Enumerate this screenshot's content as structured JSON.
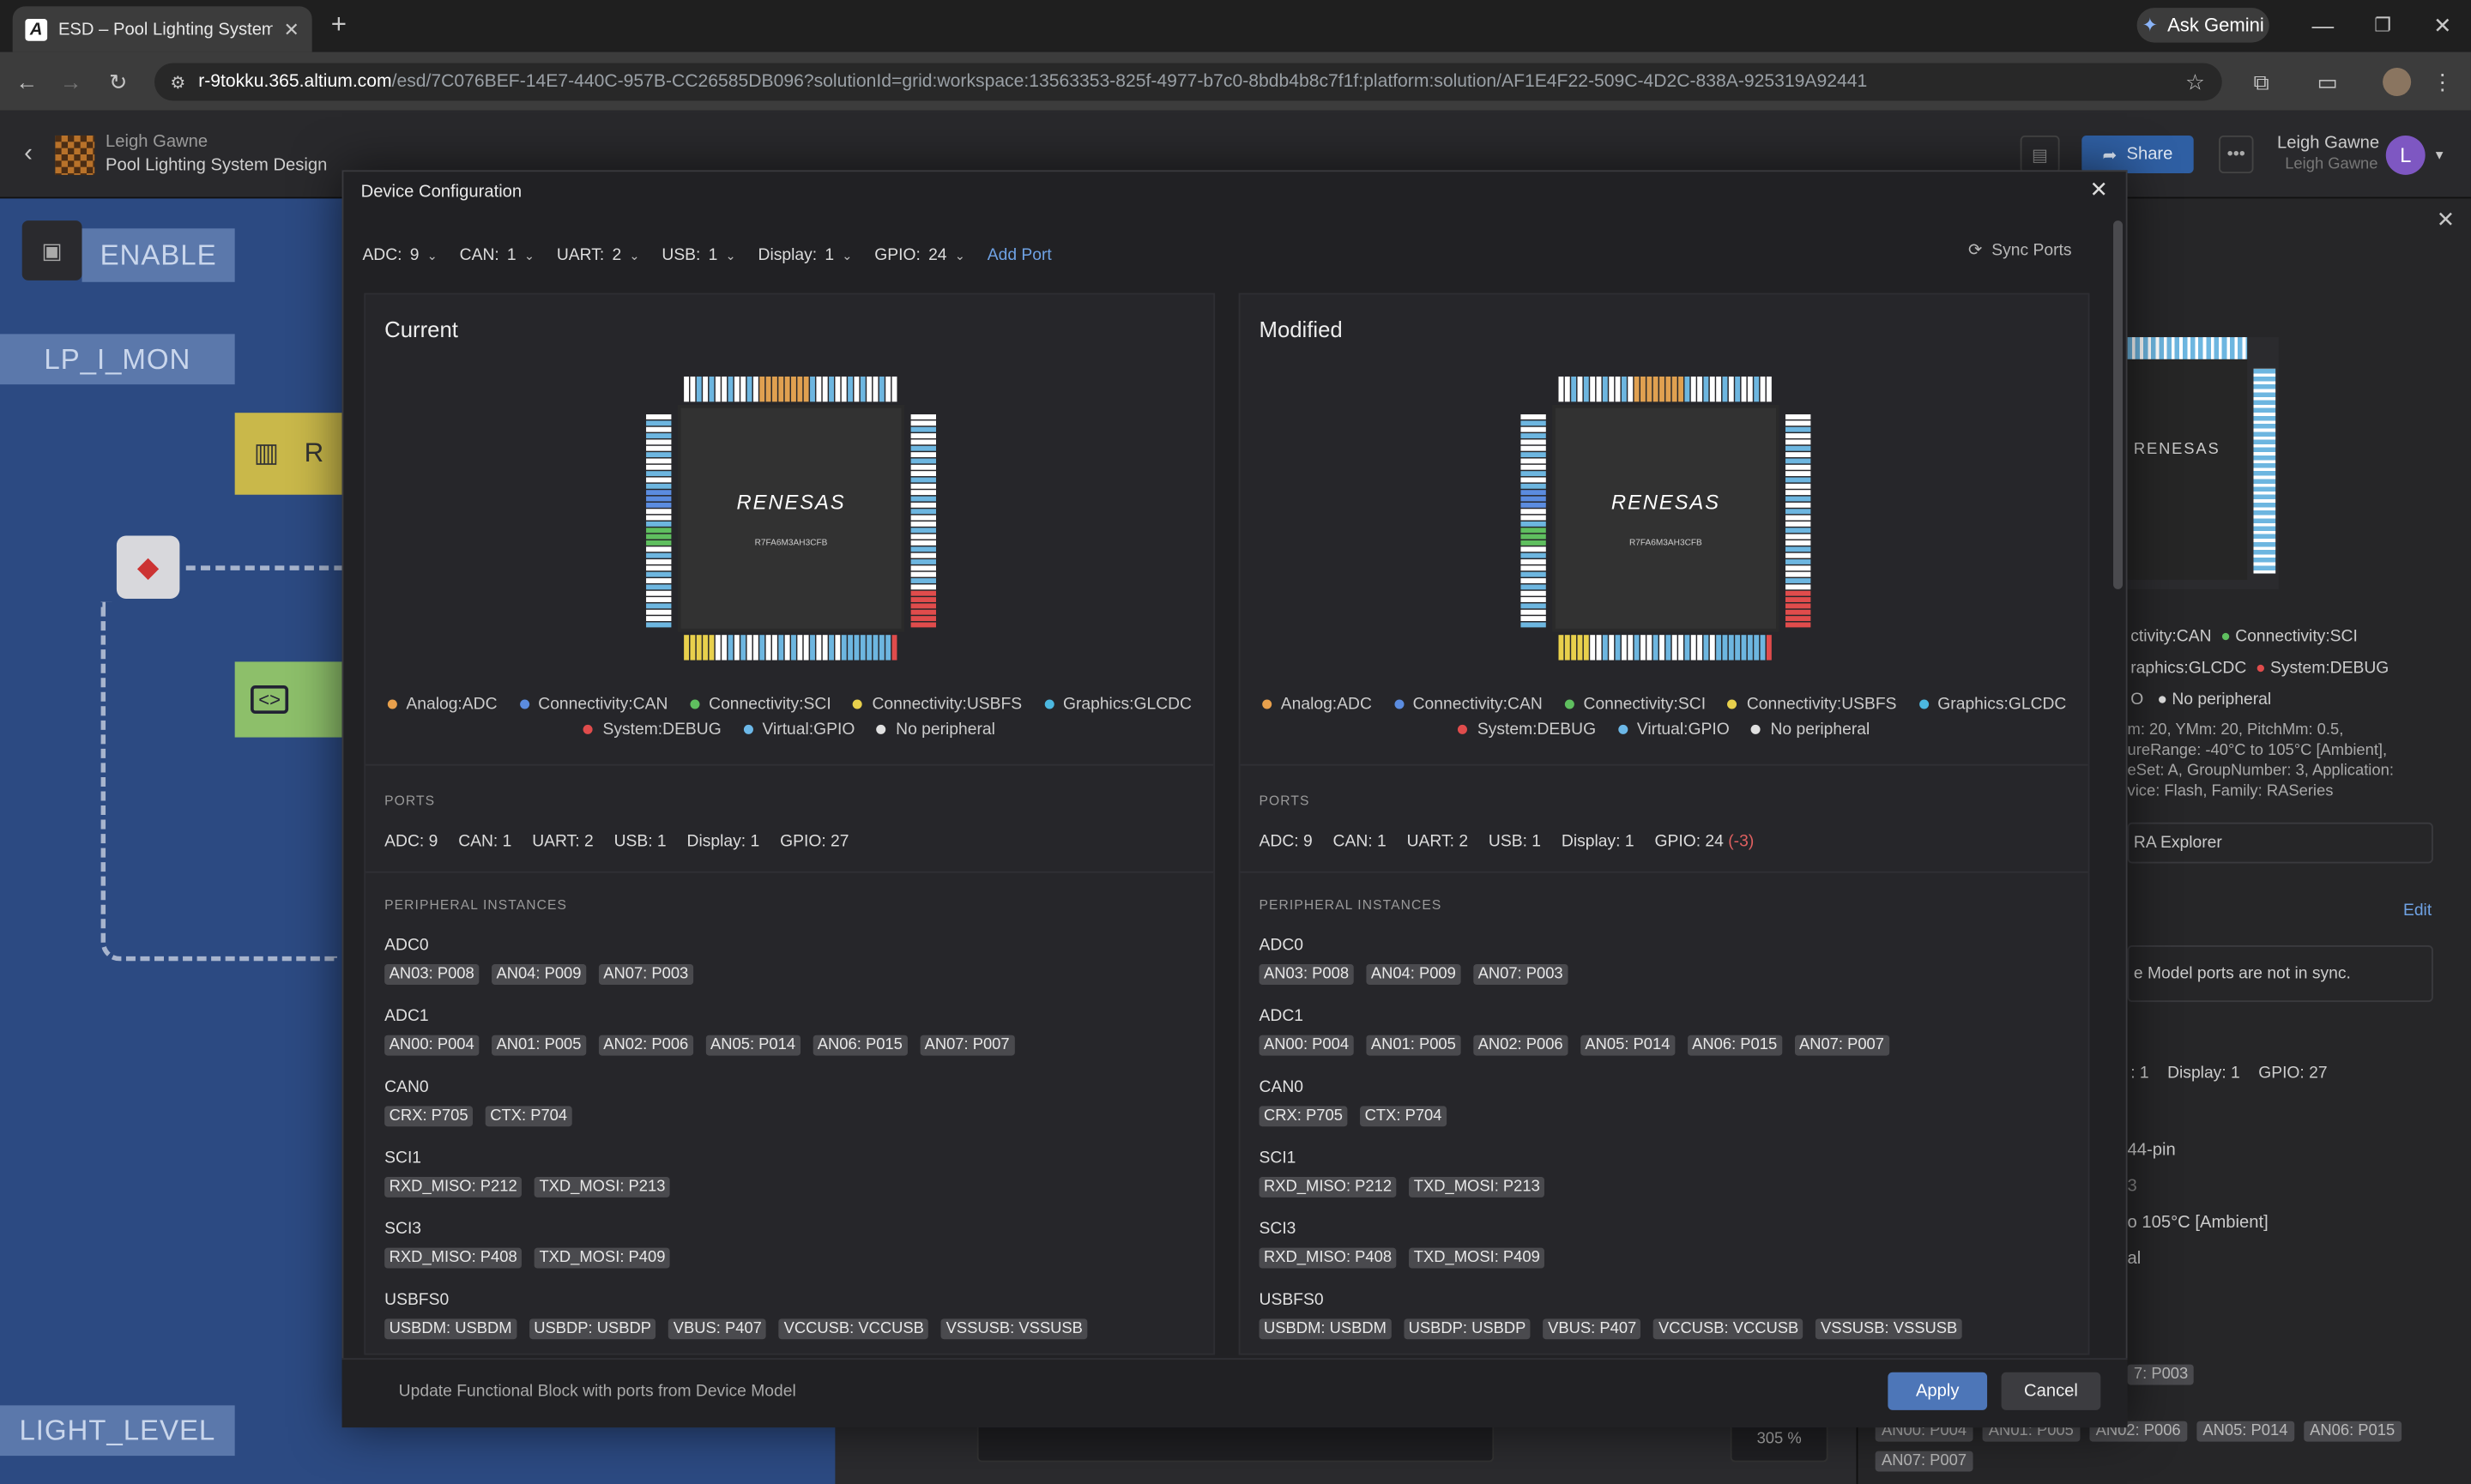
{
  "browser": {
    "tab_title": "ESD – Pool Lighting System Des",
    "url_host": "r-9tokku.365.altium.com",
    "url_path": "/esd/7C076BEF-14E7-440C-957B-CC26585DB096?solutionId=grid:workspace:13563353-825f-4977-b7c0-8bdb4b8c7f1f:platform:solution/AF1E4F22-509C-4D2C-838A-925319A92441",
    "gemini_label": "Ask Gemini"
  },
  "app": {
    "owner": "Leigh Gawne",
    "project_name": "Pool Lighting System Design",
    "share_label": "Share",
    "user_name": "Leigh Gawne",
    "user_sub": "Leigh Gawne",
    "avatar_letter": "L"
  },
  "canvas": {
    "labels": [
      "ENABLE",
      "LP_I_MON",
      "LIGHT_LEVEL"
    ],
    "block_letter": "R",
    "zoom": "305 %"
  },
  "right_pane": {
    "legend": [
      "ctivity:CAN",
      "Connectivity:SCI",
      "raphics:GLCDC",
      "System:DEBUG",
      "O",
      "No peripheral"
    ],
    "desc": [
      "m: 20, YMm: 20, PitchMm: 0.5,",
      "ureRange: -40°C to 105°C [Ambient],",
      "eSet: A, GroupNumber: 3, Application:",
      "vice: Flash, Family: RASeries"
    ],
    "ra_explorer": "RA Explorer",
    "edit": "Edit",
    "sync_msg": "e Model ports are not in sync.",
    "ports_line": ": 1    Display: 1    GPIO: 27",
    "pin_text": "44-pin",
    "b_text": "3",
    "temp": "o 105°C [Ambient]",
    "al": "al",
    "tag_p003": "7: P003",
    "tags_bottom": [
      "AN00: P004",
      "AN01: P005",
      "AN02: P006",
      "AN05: P014",
      "AN06: P015"
    ],
    "tag_an07": "AN07: P007"
  },
  "modal": {
    "title": "Device Configuration",
    "port_controls": [
      {
        "label": "ADC:",
        "value": "9"
      },
      {
        "label": "CAN:",
        "value": "1"
      },
      {
        "label": "UART:",
        "value": "2"
      },
      {
        "label": "USB:",
        "value": "1"
      },
      {
        "label": "Display:",
        "value": "1"
      },
      {
        "label": "GPIO:",
        "value": "24"
      }
    ],
    "add_port": "Add Port",
    "sync_ports": "Sync Ports",
    "chip_brand": "RENESAS",
    "chip_part": "R7FA6M3AH3CFB",
    "legend": [
      {
        "name": "Analog:ADC",
        "color": "#e8a04c"
      },
      {
        "name": "Connectivity:CAN",
        "color": "#5b8ce0"
      },
      {
        "name": "Connectivity:SCI",
        "color": "#5fbf5f"
      },
      {
        "name": "Connectivity:USBFS",
        "color": "#e8d04c"
      },
      {
        "name": "Graphics:GLCDC",
        "color": "#4cb8e0"
      },
      {
        "name": "System:DEBUG",
        "color": "#e04c4c"
      },
      {
        "name": "Virtual:GPIO",
        "color": "#6cb8e8"
      },
      {
        "name": "No peripheral",
        "color": "#e0e0e0"
      }
    ],
    "ports_header": "PORTS",
    "instances_header": "PERIPHERAL INSTANCES",
    "current": {
      "title": "Current",
      "ports": [
        "ADC: 9",
        "CAN: 1",
        "UART: 2",
        "USB: 1",
        "Display: 1",
        "GPIO: 27"
      ],
      "gpio_delta": ""
    },
    "modified": {
      "title": "Modified",
      "ports": [
        "ADC: 9",
        "CAN: 1",
        "UART: 2",
        "USB: 1",
        "Display: 1",
        "GPIO: 24"
      ],
      "gpio_delta": "(-3)"
    },
    "instances": [
      {
        "name": "ADC0",
        "tags": [
          "AN03: P008",
          "AN04: P009",
          "AN07: P003"
        ]
      },
      {
        "name": "ADC1",
        "tags": [
          "AN00: P004",
          "AN01: P005",
          "AN02: P006",
          "AN05: P014",
          "AN06: P015",
          "AN07: P007"
        ]
      },
      {
        "name": "CAN0",
        "tags": [
          "CRX: P705",
          "CTX: P704"
        ]
      },
      {
        "name": "SCI1",
        "tags": [
          "RXD_MISO: P212",
          "TXD_MOSI: P213"
        ]
      },
      {
        "name": "SCI3",
        "tags": [
          "RXD_MISO: P408",
          "TXD_MOSI: P409"
        ]
      },
      {
        "name": "USBFS0",
        "tags": [
          "USBDM: USBDM",
          "USBDP: USBDP",
          "VBUS: P407",
          "VCCUSB: VCCUSB",
          "VSSUSB: VSSUSB"
        ]
      }
    ],
    "footer_note": "Update Functional Block with ports from Device Model",
    "apply_label": "Apply",
    "cancel_label": "Cancel"
  }
}
